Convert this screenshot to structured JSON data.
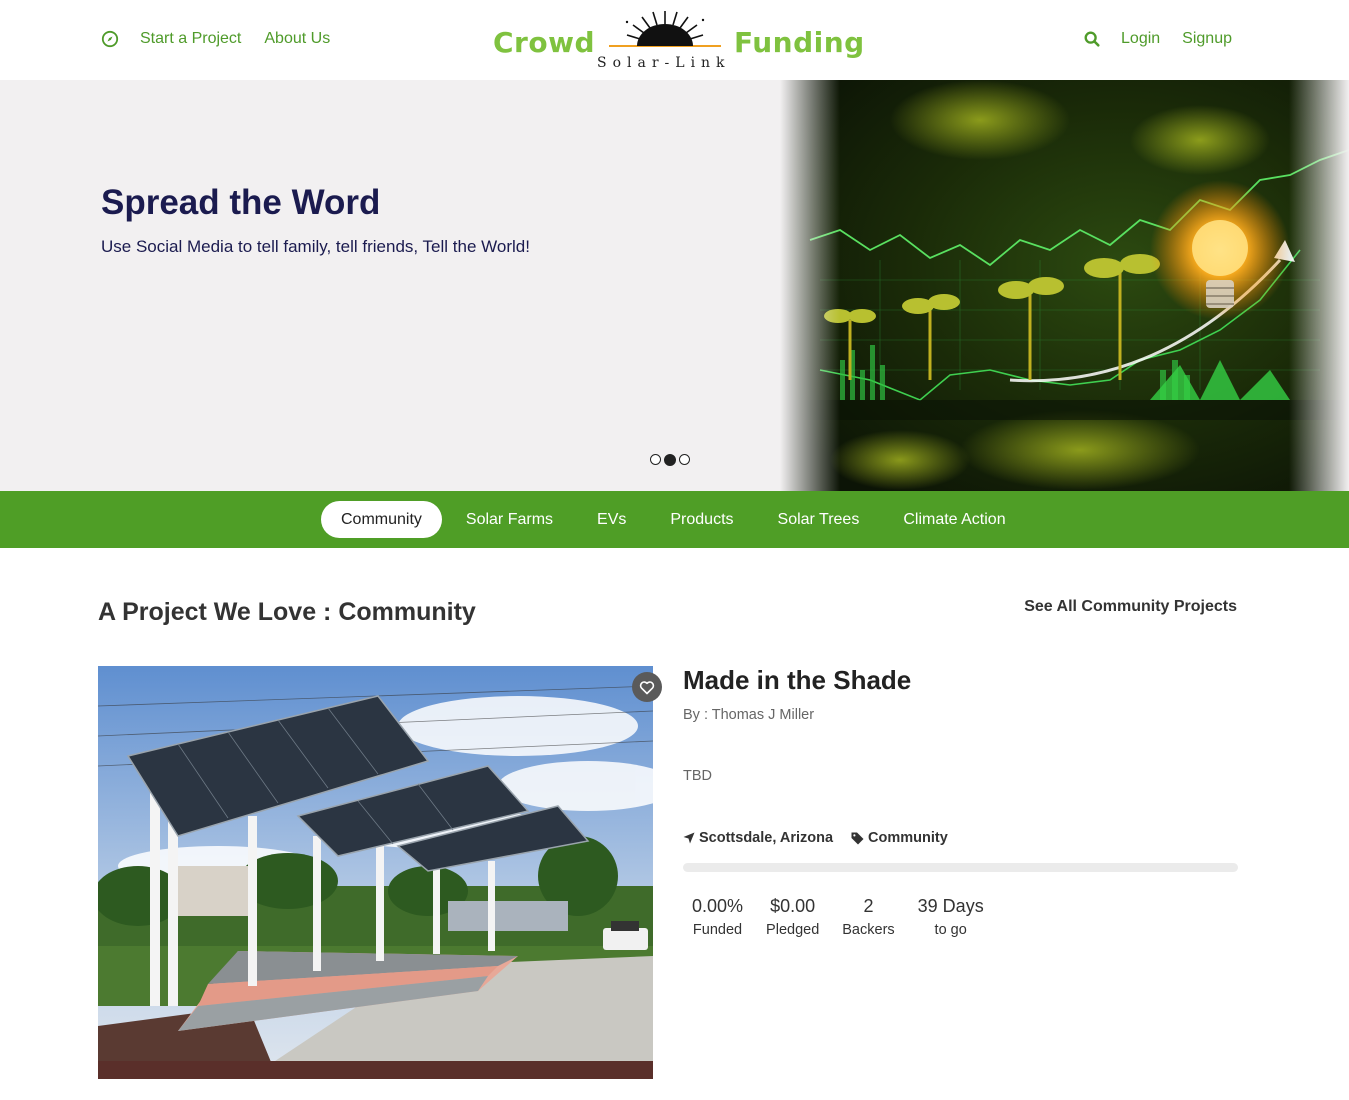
{
  "header": {
    "nav_left": [
      {
        "label": "Start a Project",
        "icon": "compass-icon"
      },
      {
        "label": "About Us"
      }
    ],
    "logo": {
      "left": "Crowd",
      "right": "Funding",
      "sub": "Solar-Link"
    },
    "nav_right": [
      {
        "label": "Login"
      },
      {
        "label": "Signup"
      }
    ]
  },
  "hero": {
    "title": "Spread the Word",
    "subtitle": "Use Social Media to tell family, tell friends, Tell the World!",
    "slides": 3,
    "active_slide": 2
  },
  "categories": [
    {
      "label": "Community",
      "active": true
    },
    {
      "label": "Solar Farms"
    },
    {
      "label": "EVs"
    },
    {
      "label": "Products"
    },
    {
      "label": "Solar Trees"
    },
    {
      "label": "Climate Action"
    }
  ],
  "featured": {
    "section_title": "A Project We Love : Community",
    "see_all": "See All Community Projects",
    "project": {
      "title": "Made in the Shade",
      "by": "By : Thomas J Miller",
      "description": "TBD",
      "location": "Scottsdale, Arizona",
      "category": "Community",
      "funded_fraction": 0.0,
      "stats": [
        {
          "value": "0.00%",
          "label": "Funded"
        },
        {
          "value": "$0.00",
          "label": "Pledged"
        },
        {
          "value": "2",
          "label": "Backers"
        },
        {
          "value": "39 Days",
          "label": "to go"
        }
      ]
    }
  },
  "colors": {
    "brand_green": "#4f9e26",
    "logo_green": "#7fc23f",
    "hero_title": "#1b1b4f"
  }
}
